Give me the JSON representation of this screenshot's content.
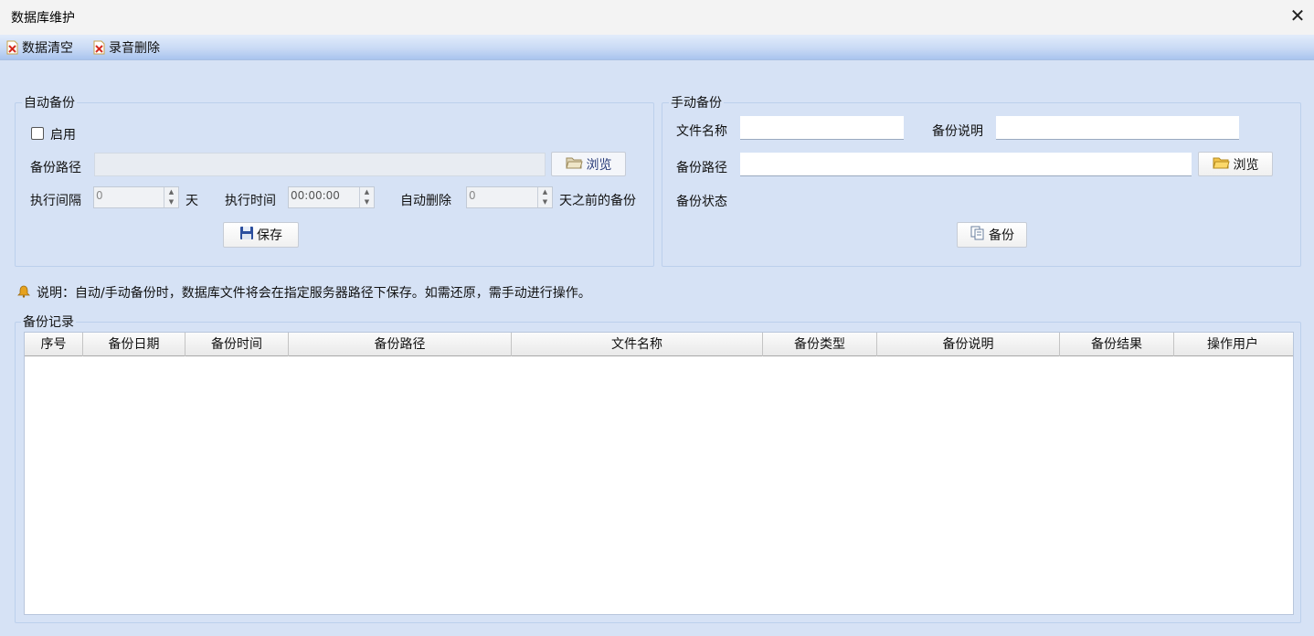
{
  "window": {
    "title": "数据库维护"
  },
  "toolbar": {
    "clear_data": "数据清空",
    "delete_recording": "录音删除"
  },
  "auto_backup": {
    "group_title": "自动备份",
    "enable_label": "启用",
    "path_label": "备份路径",
    "path_value": "",
    "browse_label": "浏览",
    "interval_label": "执行间隔",
    "interval_value": "0",
    "interval_unit": "天",
    "time_label": "执行时间",
    "time_value": "00:00:00",
    "auto_delete_label": "自动删除",
    "auto_delete_value": "0",
    "auto_delete_suffix": "天之前的备份",
    "save_label": "保存"
  },
  "manual_backup": {
    "group_title": "手动备份",
    "file_name_label": "文件名称",
    "file_name_value": "",
    "desc_label": "备份说明",
    "desc_value": "",
    "path_label": "备份路径",
    "path_value": "",
    "browse_label": "浏览",
    "status_label": "备份状态",
    "backup_label": "备份"
  },
  "note": "说明：自动/手动备份时，数据库文件将会在指定服务器路径下保存。如需还原，需手动进行操作。",
  "records": {
    "group_title": "备份记录",
    "columns": [
      "序号",
      "备份日期",
      "备份时间",
      "备份路径",
      "文件名称",
      "备份类型",
      "备份说明",
      "备份结果",
      "操作用户"
    ],
    "rows": []
  }
}
